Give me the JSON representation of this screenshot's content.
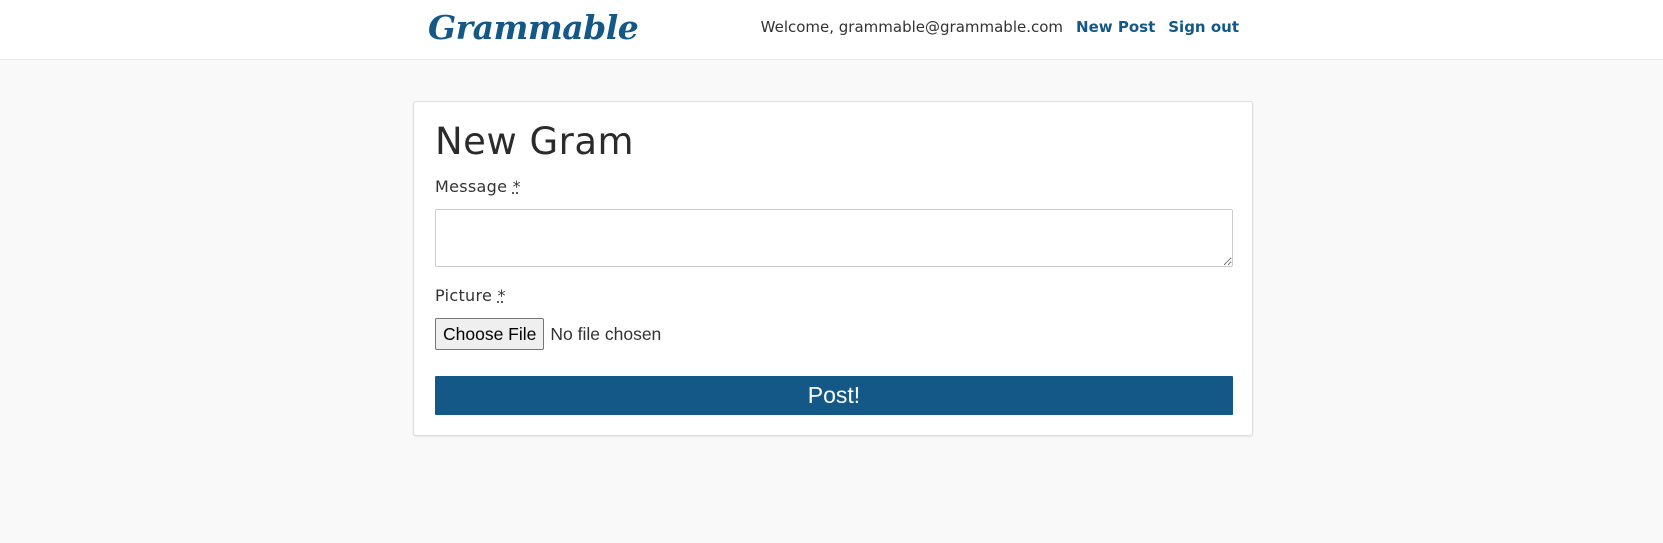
{
  "navbar": {
    "brand": "Grammable",
    "welcome_text": "Welcome, grammable@grammable.com",
    "new_post_label": "New Post",
    "sign_out_label": "Sign out"
  },
  "form": {
    "title": "New Gram",
    "message_label": "Message",
    "picture_label": "Picture",
    "required_marker": "*",
    "required_title": "required",
    "message_value": "",
    "choose_file_label": "Choose File",
    "file_status": "No file chosen",
    "submit_label": "Post!"
  },
  "colors": {
    "accent": "#135886",
    "page_background": "#f9f9f9",
    "panel_background": "#ffffff"
  }
}
